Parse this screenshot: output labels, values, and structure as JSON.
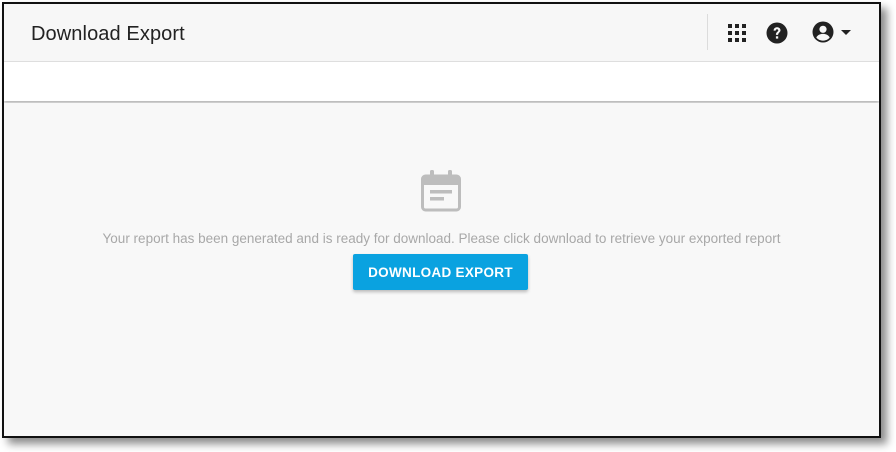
{
  "header": {
    "title": "Download Export",
    "icons": {
      "apps": "apps-grid-icon",
      "help": "help-circle-icon",
      "account": "account-circle-icon",
      "dropdown": "caret-down-icon"
    }
  },
  "main": {
    "icon": "calendar-icon",
    "message": "Your report has been generated and is ready for download. Please click download to retrieve your exported report",
    "download_label": "DOWNLOAD EXPORT"
  },
  "colors": {
    "accent": "#0AA2E0",
    "icon_dark": "#222222",
    "icon_muted": "#BDBDBD",
    "message_text": "#A8A8A8"
  }
}
